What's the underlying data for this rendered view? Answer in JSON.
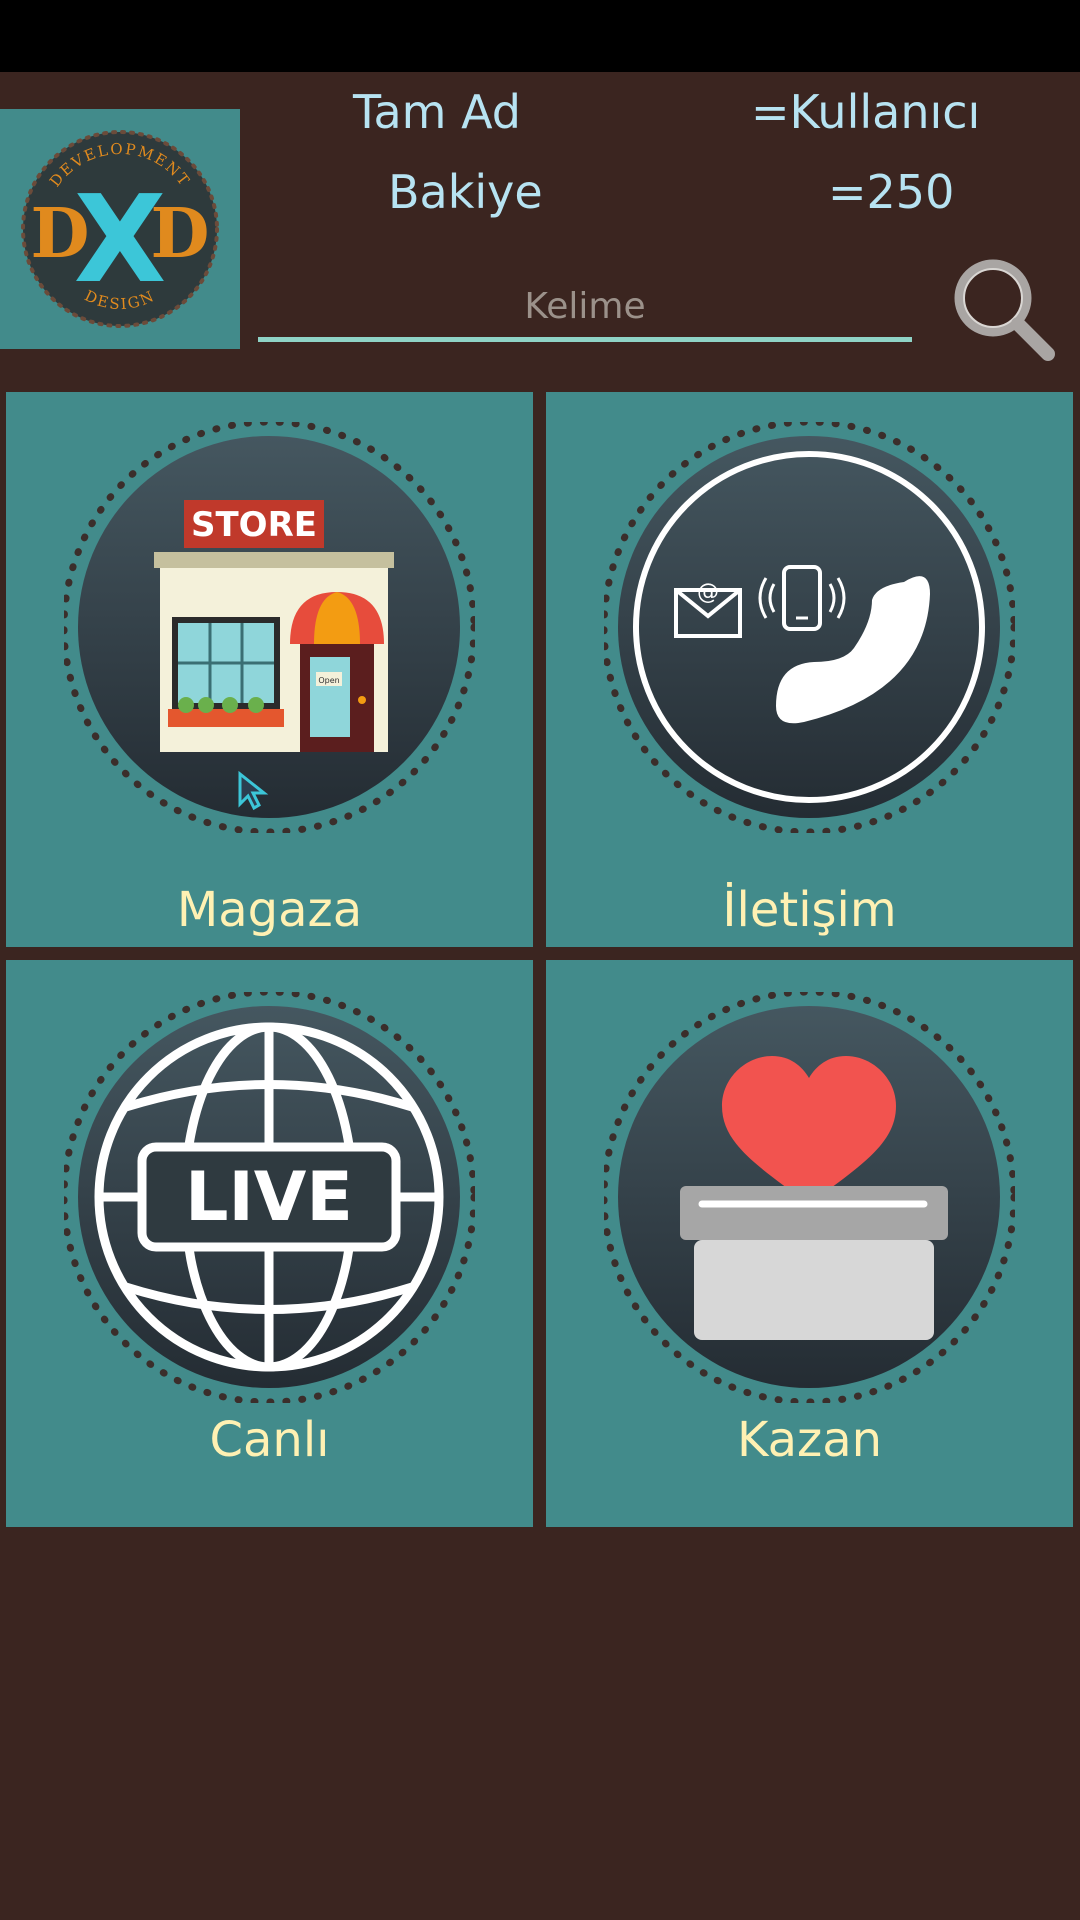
{
  "header": {
    "logo_text": {
      "top": "DEVELOPMENT",
      "left": "D",
      "middle": "X",
      "right": "D",
      "bottom": "DESIGN"
    },
    "name_label": "Tam Ad",
    "name_value": "=Kullanıcı",
    "balance_label": "Bakiye",
    "balance_value": "=250"
  },
  "search": {
    "placeholder": "Kelime",
    "value": ""
  },
  "tiles": [
    {
      "label": "Magaza",
      "icon": "store-icon",
      "icon_text": "STORE",
      "sign_text": "Open"
    },
    {
      "label": "İletişim",
      "icon": "contact-icon"
    },
    {
      "label": "Canlı",
      "icon": "live-globe-icon",
      "icon_text": "LIVE"
    },
    {
      "label": "Kazan",
      "icon": "donation-heart-icon"
    }
  ],
  "colors": {
    "background": "#3b2520",
    "tile": "#428b8b",
    "tile_label": "#fff1b3",
    "header_text": "#b7e3f2",
    "search_underline": "#8fd3c6",
    "status_bar": "#000000"
  }
}
